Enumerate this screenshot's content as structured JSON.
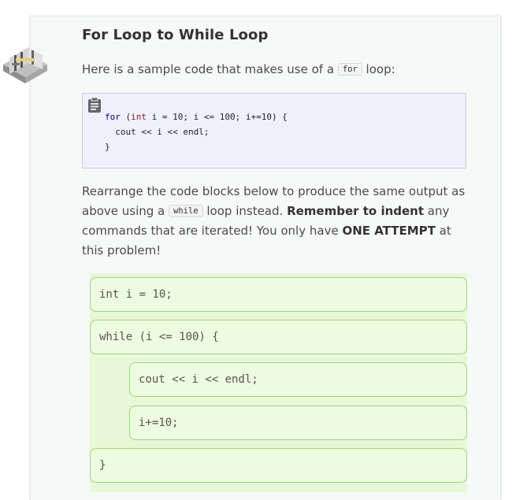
{
  "title": "For Loop to While Loop",
  "intro": {
    "before": "Here is a sample code that makes use of a ",
    "code": "for",
    "after": " loop:"
  },
  "sample_code": {
    "line1": {
      "kw": "for",
      "open": " (",
      "type": "int",
      "rest": " i = 10; i <= 100; i+=10) {"
    },
    "line2": "  cout << i << endl;",
    "line3": "}"
  },
  "instructions": {
    "part1": "Rearrange the code blocks below to produce the same output as above using a ",
    "code": "while",
    "part2": " loop instead. ",
    "bold1": "Remember to indent",
    "part3": " any commands that are iterated! You only have ",
    "bold2": "ONE ATTEMPT",
    "part4": " at this problem!"
  },
  "blocks": [
    {
      "text": "int i = 10;",
      "indent": 0
    },
    {
      "text": "while (i <= 100) {",
      "indent": 0
    },
    {
      "text": "cout << i << endl;",
      "indent": 1
    },
    {
      "text": "i+=10;",
      "indent": 1
    },
    {
      "text": "}",
      "indent": 0
    }
  ],
  "colors": {
    "block_bg": "#edfbe0",
    "block_border": "#9ed57f",
    "area_bg": "#e8f7d8",
    "code_box_bg": "#eef1fb"
  },
  "icons": {
    "logo": "course-logo-icon",
    "clipboard": "clipboard-icon"
  }
}
